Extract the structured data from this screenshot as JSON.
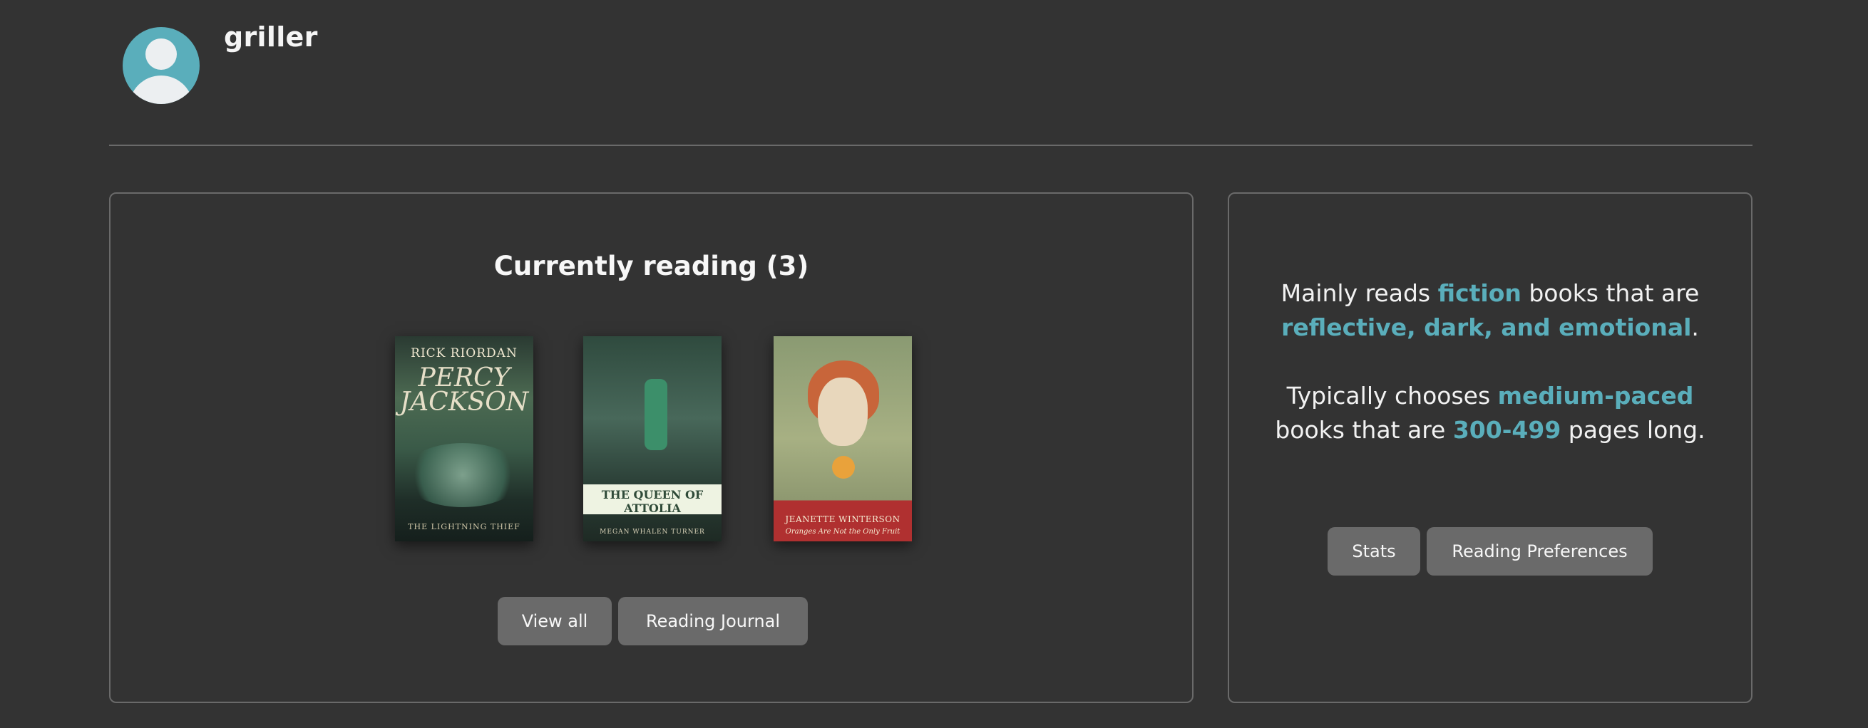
{
  "profile": {
    "username": "griller",
    "avatar_icon": "user-placeholder-icon"
  },
  "reading": {
    "title": "Currently reading (3)",
    "books": [
      {
        "author": "RICK RIORDAN",
        "title": "PERCY JACKSON",
        "subtitle": "THE LIGHTNING THIEF"
      },
      {
        "title": "THE QUEEN OF ATTOLIA",
        "author": "MEGAN WHALEN TURNER"
      },
      {
        "author": "JEANETTE WINTERSON",
        "title": "Oranges Are Not the Only Fruit"
      }
    ],
    "buttons": {
      "view_all": "View all",
      "journal": "Reading Journal"
    }
  },
  "preferences": {
    "line1_pre": "Mainly reads ",
    "genre": "fiction",
    "line1_mid": " books that are ",
    "moods": "reflective, dark, and emotional",
    "line1_end": ".",
    "line2_pre": "Typically chooses ",
    "pace": "medium-paced",
    "line2_mid": " books that are ",
    "pages": "300-499",
    "line2_end": " pages long.",
    "buttons": {
      "stats": "Stats",
      "prefs": "Reading Preferences"
    }
  },
  "colors": {
    "accent": "#5aaebb",
    "background": "#333333",
    "button": "#6a6a6a"
  }
}
